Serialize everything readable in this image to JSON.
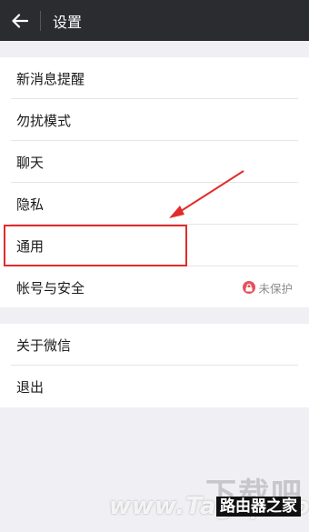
{
  "header": {
    "title": "设置",
    "back_icon": "arrow-left-icon"
  },
  "menu_group_1": [
    {
      "label": "新消息提醒"
    },
    {
      "label": "勿扰模式"
    },
    {
      "label": "聊天"
    },
    {
      "label": "隐私"
    },
    {
      "label": "通用"
    },
    {
      "label": "帐号与安全",
      "status": "未保护",
      "status_icon": "lock-icon"
    }
  ],
  "menu_group_2": [
    {
      "label": "关于微信"
    },
    {
      "label": "退出"
    }
  ],
  "annotation": {
    "color": "#e22b2b"
  },
  "watermark": {
    "site": "下载吧",
    "domain": "www.Tagxp.com",
    "badge": "路由器之家"
  },
  "colors": {
    "topbar": "#2b2c30",
    "background": "#efeff4",
    "danger": "#e6505b"
  }
}
